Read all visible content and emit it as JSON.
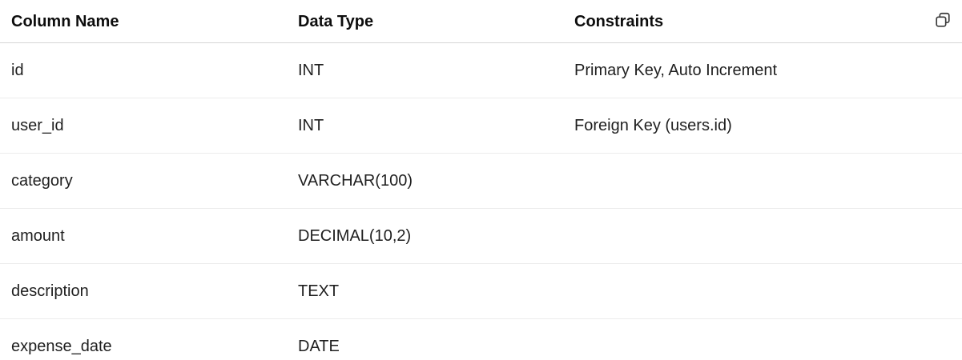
{
  "table": {
    "headers": [
      "Column Name",
      "Data Type",
      "Constraints"
    ],
    "rows": [
      [
        "id",
        "INT",
        "Primary Key, Auto Increment"
      ],
      [
        "user_id",
        "INT",
        "Foreign Key (users.id)"
      ],
      [
        "category",
        "VARCHAR(100)",
        ""
      ],
      [
        "amount",
        "DECIMAL(10,2)",
        ""
      ],
      [
        "description",
        "TEXT",
        ""
      ],
      [
        "expense_date",
        "DATE",
        ""
      ]
    ]
  },
  "icons": {
    "copy": "copy-icon"
  }
}
